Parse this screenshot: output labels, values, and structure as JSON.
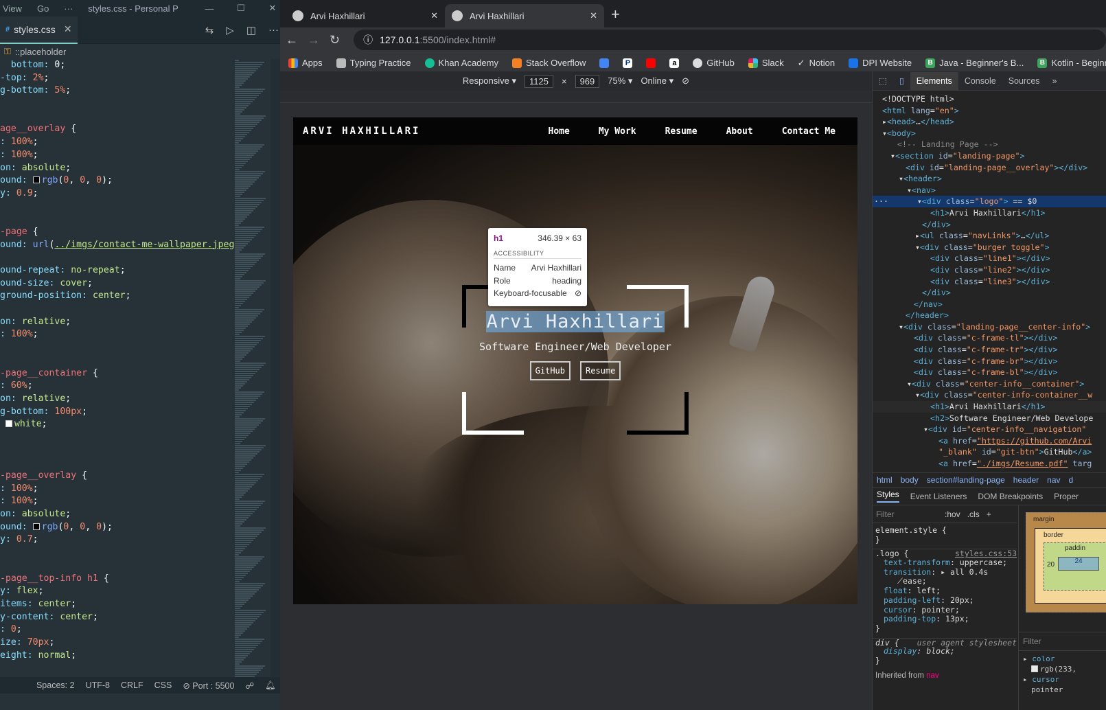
{
  "vscode": {
    "menu": [
      "View",
      "Go",
      "···"
    ],
    "window_title": "styles.css - Personal Portfolio -...",
    "tab": "styles.css",
    "breadcrumb": "::placeholder",
    "status": {
      "spaces": "Spaces: 2",
      "encoding": "UTF-8",
      "eol": "CRLF",
      "lang": "CSS",
      "port": "Port : 5500"
    }
  },
  "chrome": {
    "tabs": [
      "Arvi Haxhillari",
      "Arvi Haxhillari"
    ],
    "url_host": "127.0.0.1",
    "url_rest": ":5500/index.html#",
    "bookmarks": [
      "Apps",
      "Typing Practice",
      "Khan Academy",
      "Stack Overflow",
      "",
      "",
      "",
      "",
      "GitHub",
      "Slack",
      "Notion",
      "DPI Website",
      "Java - Beginner's B...",
      "Kotlin - Beginner's..."
    ],
    "device": {
      "mode": "Responsive",
      "width": "1125",
      "height": "969",
      "zoom": "75%",
      "net": "Online"
    }
  },
  "site": {
    "logo": "ARVI HAXHILLARI",
    "nav": [
      "Home",
      "My Work",
      "Resume",
      "About",
      "Contact Me"
    ],
    "h1": "Arvi Haxhillari",
    "h2": "Software Engineer/Web Developer",
    "btn_github": "GitHub",
    "btn_resume": "Resume"
  },
  "tooltip": {
    "tag": "h1",
    "size": "346.39 × 63",
    "section": "ACCESSIBILITY",
    "name_label": "Name",
    "name": "Arvi Haxhillari",
    "role_label": "Role",
    "role": "heading",
    "kb": "Keyboard-focusable"
  },
  "devtools": {
    "tabs": [
      "Elements",
      "Console",
      "Sources",
      "»"
    ],
    "crumbs": [
      "html",
      "body",
      "section#landing-page",
      "header",
      "nav",
      "d"
    ],
    "subtabs": [
      "Styles",
      "Event Listeners",
      "DOM Breakpoints",
      "Proper"
    ],
    "filter": "Filter",
    "hov": ":hov",
    "cls": ".cls",
    "computed_filter": "Filter",
    "boxmodel": {
      "margin": "margin",
      "border": "border",
      "padding": "paddin",
      "left": "20",
      "val": "24"
    },
    "computed": [
      "color",
      "rgb(233,",
      "cursor",
      "pointer"
    ],
    "inherited": "Inherited from",
    "inherited_tag": "nav"
  }
}
